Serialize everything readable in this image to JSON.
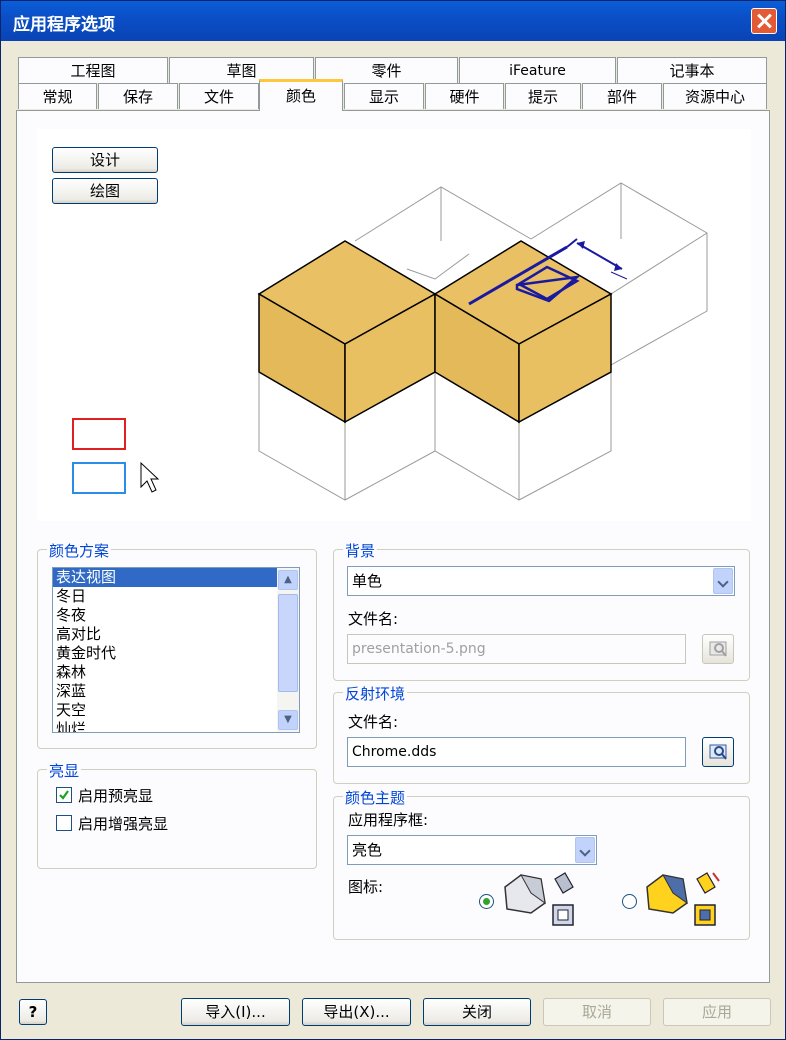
{
  "window": {
    "title": "应用程序选项"
  },
  "tabs_row1": [
    "工程图",
    "草图",
    "零件",
    "iFeature",
    "记事本"
  ],
  "tabs_row2": [
    "常规",
    "保存",
    "文件",
    "颜色",
    "显示",
    "硬件",
    "提示",
    "部件",
    "资源中心"
  ],
  "active_tab": "颜色",
  "preview": {
    "design_button": "设计",
    "drawing_button": "绘图"
  },
  "color_scheme": {
    "label": "颜色方案",
    "items": [
      "表达视图",
      "冬日",
      "冬夜",
      "高对比",
      "黄金时代",
      "森林",
      "深蓝",
      "天空",
      "灿烂"
    ],
    "selected": "表达视图"
  },
  "highlight": {
    "label": "亮显",
    "enable_prehighlight": "启用预亮显",
    "enable_prehighlight_checked": true,
    "enable_enhanced": "启用增强亮显",
    "enable_enhanced_checked": false
  },
  "background": {
    "label": "背景",
    "mode": "单色",
    "filename_label": "文件名:",
    "filename": "presentation-5.png"
  },
  "reflection": {
    "label": "反射环境",
    "filename_label": "文件名:",
    "filename": "Chrome.dds"
  },
  "color_theme": {
    "label": "颜色主题",
    "app_frame_label": "应用程序框:",
    "app_frame": "亮色",
    "icons_label": "图标:"
  },
  "footer": {
    "import": "导入(I)...",
    "export": "导出(X)...",
    "close": "关闭",
    "cancel": "取消",
    "apply": "应用"
  },
  "colors": {
    "accent": "#0046d5",
    "face": "#e8bf61",
    "edge_blue": "#1a1aa0"
  }
}
